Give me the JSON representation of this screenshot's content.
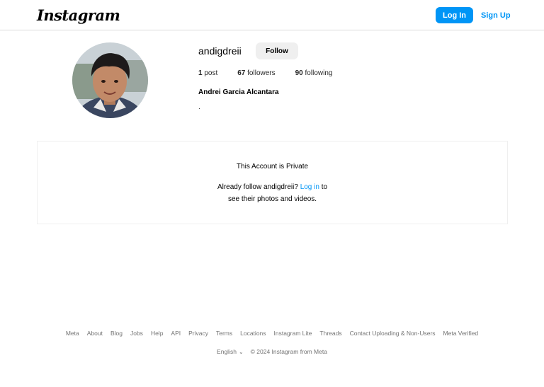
{
  "header": {
    "logo": "Instagram",
    "login_label": "Log In",
    "signup_label": "Sign Up"
  },
  "profile": {
    "username": "andigdreii",
    "follow_label": "Follow",
    "posts_count": "1",
    "posts_label": "post",
    "followers_count": "67",
    "followers_label": "followers",
    "following_count": "90",
    "following_label": "following",
    "full_name": "Andrei Garcia Alcantara",
    "bio": "."
  },
  "private": {
    "title": "This Account is Private",
    "desc_prefix": "Already follow andigdreii?",
    "login_link": "Log in",
    "desc_suffix": "to",
    "desc_line2": "see their photos and videos."
  },
  "footer": {
    "links": [
      "Meta",
      "About",
      "Blog",
      "Jobs",
      "Help",
      "API",
      "Privacy",
      "Terms",
      "Locations",
      "Instagram Lite",
      "Threads",
      "Contact Uploading & Non-Users",
      "Meta Verified"
    ],
    "language": "English",
    "copyright": "© 2024 Instagram from Meta"
  },
  "colors": {
    "accent": "#0095f6",
    "border": "#dbdbdb",
    "muted_text": "#737373"
  }
}
